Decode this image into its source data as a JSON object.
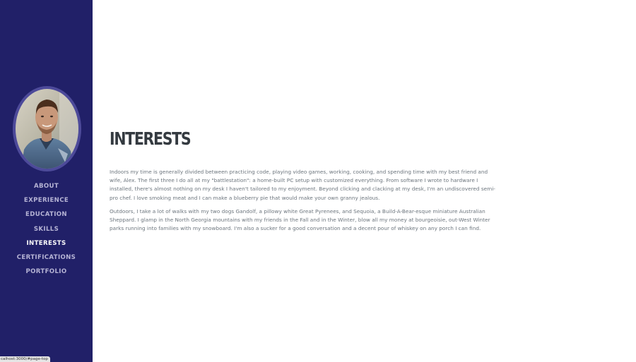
{
  "sidebar": {
    "nav": [
      {
        "label": "ABOUT"
      },
      {
        "label": "EXPERIENCE"
      },
      {
        "label": "EDUCATION"
      },
      {
        "label": "SKILLS"
      },
      {
        "label": "INTERESTS"
      },
      {
        "label": "CERTIFICATIONS"
      },
      {
        "label": "PORTFOLIO"
      }
    ],
    "active_item": "INTERESTS"
  },
  "main": {
    "title": "Interests",
    "paragraphs": [
      "Indoors my time is generally divided between practicing code, playing video games, working, cooking, and spending time with my best friend and wife, Alex. The first three I do all at my \"battlestation\": a home-built PC setup with customized everything. From software I wrote to hardware I installed, there's almost nothing on my desk I haven't tailored to my enjoyment. Beyond clicking and clacking at my desk, I'm an undiscovered semi-pro chef. I love smoking meat and I can make a blueberry pie that would make your own granny jealous.",
      "Outdoors, I take a lot of walks with my two dogs Gandolf, a pillowy white Great Pyrenees, and Sequoia, a Build-A-Bear-esque miniature Australian Sheppard. I glamp in the North Georgia mountains with my friends in the Fall and in the Winter, blow all my money at bourgeoisie, out-West Winter parks running into families with my snowboard. I'm also a sucker for a good conversation and a decent pour of whiskey on any porch I can find."
    ]
  },
  "status_bar": {
    "url": "calhost:3000/#page-top"
  },
  "colors": {
    "sidebar_bg": "#212068",
    "nav_text": "#b5b3d4",
    "nav_active": "#ffffff",
    "heading": "#343a40",
    "body_text": "#6c757d"
  }
}
